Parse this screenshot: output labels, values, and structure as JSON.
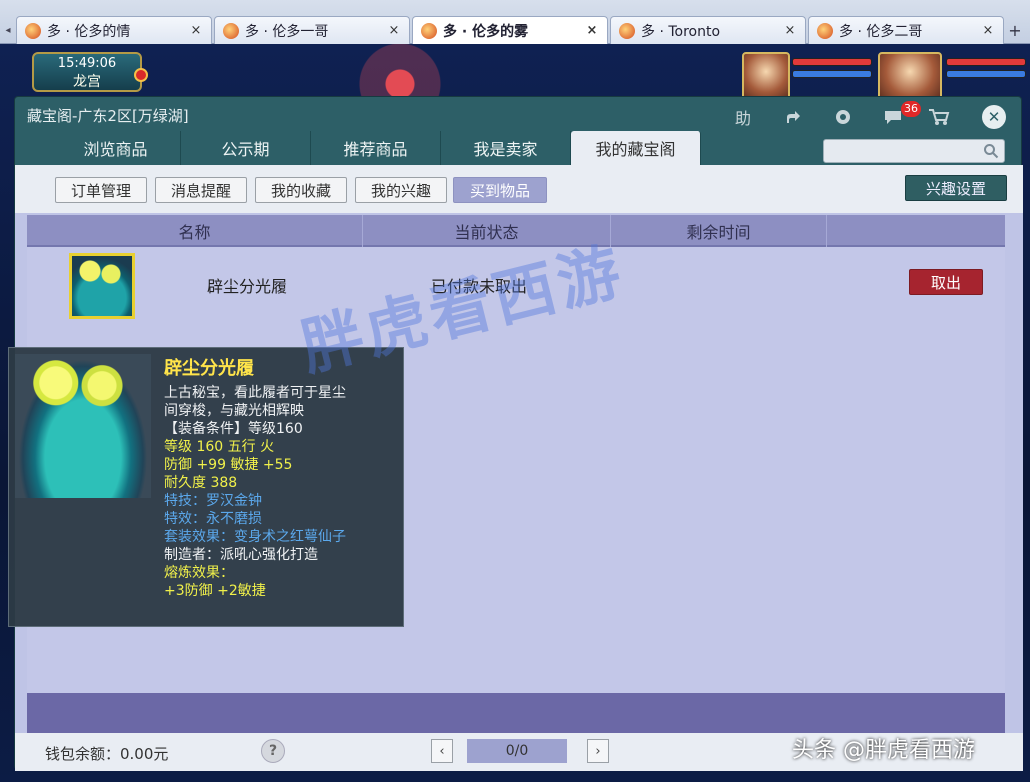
{
  "browser": {
    "tabs": [
      {
        "label": "多 · 伦多的情",
        "active": false
      },
      {
        "label": "多 · 伦多一哥",
        "active": false
      },
      {
        "label": "多 · 伦多的雾",
        "active": true
      },
      {
        "label": "多 · Toronto",
        "active": false
      },
      {
        "label": "多 · 伦多二哥",
        "active": false
      }
    ],
    "close_glyph": "×",
    "add_glyph": "+",
    "prev_glyph": "◂"
  },
  "game": {
    "clock": "15:49:06",
    "location": "龙宫"
  },
  "window": {
    "title": "藏宝阁-广东2区[万绿湖]",
    "help_label": "助",
    "message_badge": "36",
    "close_glyph": "✕"
  },
  "nav_tabs": [
    {
      "label": "浏览商品",
      "active": false
    },
    {
      "label": "公示期",
      "active": false
    },
    {
      "label": "推荐商品",
      "active": false
    },
    {
      "label": "我是卖家",
      "active": false
    },
    {
      "label": "我的藏宝阁",
      "active": true
    }
  ],
  "search": {
    "value": "",
    "placeholder": ""
  },
  "sub_tabs": [
    {
      "label": "订单管理",
      "active": false
    },
    {
      "label": "消息提醒",
      "active": false
    },
    {
      "label": "我的收藏",
      "active": false
    },
    {
      "label": "我的兴趣",
      "active": false
    },
    {
      "label": "买到物品",
      "active": true
    }
  ],
  "interest_settings": "兴趣设置",
  "table": {
    "columns": [
      "名称",
      "当前状态",
      "剩余时间"
    ],
    "rows": [
      {
        "name": "辟尘分光履",
        "status": "已付款未取出",
        "remaining": "",
        "action": "取出"
      }
    ]
  },
  "tooltip": {
    "title": "辟尘分光履",
    "lines": [
      {
        "text": "上古秘宝，看此履者可于星尘",
        "color": "white"
      },
      {
        "text": "间穿梭，与藏光相辉映",
        "color": "white"
      },
      {
        "text": "【装备条件】等级160",
        "color": "white"
      },
      {
        "text": "等级 160  五行 火",
        "color": "yellow"
      },
      {
        "text": "防御 +99  敏捷 +55",
        "color": "yellow"
      },
      {
        "text": "耐久度 388",
        "color": "yellow"
      },
      {
        "text": "特技：罗汉金钟",
        "color": "blue"
      },
      {
        "text": "特效：永不磨损",
        "color": "blue"
      },
      {
        "text": "套装效果：变身术之红萼仙子",
        "color": "blue"
      },
      {
        "text": "制造者：派吼心强化打造",
        "color": "white"
      },
      {
        "text": "熔炼效果：",
        "color": "yellow"
      },
      {
        "text": "+3防御 +2敏捷",
        "color": "yellow"
      }
    ]
  },
  "footer": {
    "wallet": "钱包余额：0.00元",
    "help_glyph": "?",
    "page_indicator": "0/0",
    "prev_glyph": "‹",
    "next_glyph": "›"
  },
  "watermark": "胖虎看西游",
  "credit": "头条 @胖虎看西游",
  "colors": {
    "window_teal": "#2d5f67",
    "table_header": "#8d8fc2",
    "action_red": "#a6242f",
    "tooltip_yellow": "#f0f04a",
    "tooltip_blue": "#5ba8ec"
  },
  "icons": {
    "tab_icon": "game-avatar-icon",
    "share": "share-arrow-icon",
    "settings": "gear-icon",
    "chat": "chat-bubble-icon",
    "cart": "shopping-cart-icon",
    "search": "search-icon",
    "help": "question-mark-icon"
  }
}
